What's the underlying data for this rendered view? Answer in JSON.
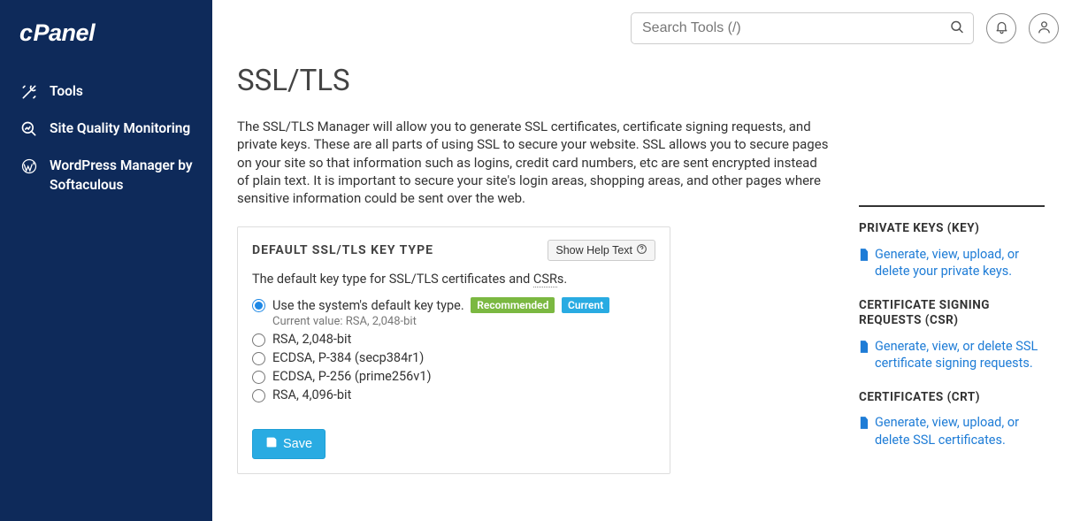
{
  "brand": "cPanel",
  "sidebar": {
    "items": [
      {
        "label": "Tools"
      },
      {
        "label": "Site Quality Monitoring"
      },
      {
        "label": "WordPress Manager by Softaculous"
      }
    ]
  },
  "search": {
    "placeholder": "Search Tools (/)"
  },
  "page": {
    "title": "SSL/TLS",
    "description": "The SSL/TLS Manager will allow you to generate SSL certificates, certificate signing requests, and private keys. These are all parts of using SSL to secure your website. SSL allows you to secure pages on your site so that information such as logins, credit card numbers, etc are sent encrypted instead of plain text. It is important to secure your site's login areas, shopping areas, and other pages where sensitive information could be sent over the web."
  },
  "panel": {
    "title": "DEFAULT SSL/TLS KEY TYPE",
    "help_button": "Show Help Text",
    "intro_prefix": "The default key type for SSL/TLS certificates and ",
    "intro_csr": "CSR",
    "intro_suffix": "s.",
    "options": [
      {
        "label": "Use the system's default key type.",
        "recommended": true,
        "current": true,
        "current_value": "Current value: RSA, 2,048-bit"
      },
      {
        "label": "RSA, 2,048-bit"
      },
      {
        "label": "ECDSA, P-384 (secp384r1)"
      },
      {
        "label": "ECDSA, P-256 (prime256v1)"
      },
      {
        "label": "RSA, 4,096-bit"
      }
    ],
    "badge_recommended": "Recommended",
    "badge_current": "Current",
    "save_label": "Save"
  },
  "right": {
    "sections": [
      {
        "title": "PRIVATE KEYS (KEY)",
        "link": "Generate, view, upload, or delete your private keys."
      },
      {
        "title": "CERTIFICATE SIGNING REQUESTS (CSR)",
        "link": "Generate, view, or delete SSL certificate signing requests."
      },
      {
        "title": "CERTIFICATES (CRT)",
        "link": "Generate, view, upload, or delete SSL certificates."
      }
    ]
  }
}
